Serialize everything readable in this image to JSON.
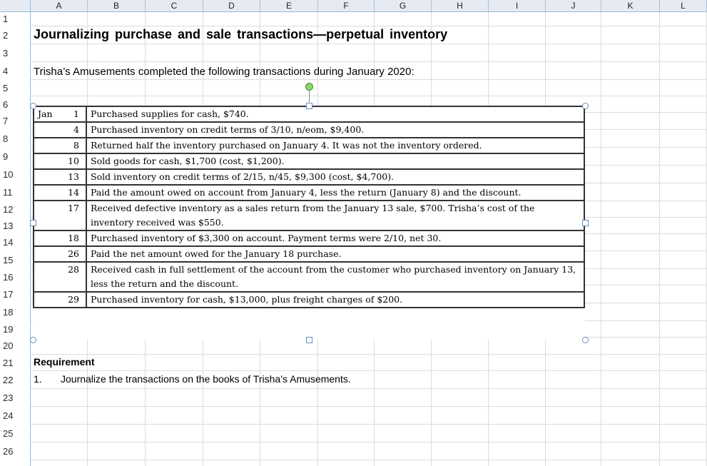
{
  "columns": [
    "A",
    "B",
    "C",
    "D",
    "E",
    "F",
    "G",
    "H",
    "I",
    "J",
    "K",
    "L"
  ],
  "rows": [
    "1",
    "2",
    "3",
    "4",
    "5",
    "6",
    "7",
    "8",
    "9",
    "10",
    "11",
    "12",
    "13",
    "14",
    "15",
    "16",
    "17",
    "18",
    "19",
    "20",
    "21",
    "22",
    "23",
    "24",
    "25",
    "26"
  ],
  "sheet": {
    "title": "Journalizing purchase and sale transactions—perpetual inventory",
    "intro": "Trisha’s Amusements completed the following transactions during January 2020:",
    "requirement_heading": "Requirement",
    "requirement_number": "1.",
    "requirement_text": "Journalize the transactions on the books of Trisha’s Amusements."
  },
  "transactions": [
    {
      "month": "Jan",
      "day": "1",
      "text": "Purchased supplies for cash, $740."
    },
    {
      "month": "",
      "day": "4",
      "text": "Purchased inventory on credit terms of 3/10, n/eom, $9,400."
    },
    {
      "month": "",
      "day": "8",
      "text": "Returned half the inventory purchased on January 4. It was not the inventory ordered."
    },
    {
      "month": "",
      "day": "10",
      "text": "Sold goods for cash, $1,700 (cost, $1,200)."
    },
    {
      "month": "",
      "day": "13",
      "text": "Sold inventory on credit terms of 2/15, n/45, $9,300 (cost, $4,700)."
    },
    {
      "month": "",
      "day": "14",
      "text": "Paid the amount owed on account from January 4, less the return (January 8) and the discount."
    },
    {
      "month": "",
      "day": "17",
      "text": "Received defective inventory as a sales return from the January 13 sale, $700. Trisha’s cost of the inventory received was $550."
    },
    {
      "month": "",
      "day": "18",
      "text": "Purchased inventory of $3,300 on account. Payment terms were 2/10, net 30."
    },
    {
      "month": "",
      "day": "26",
      "text": "Paid the net amount owed for the January 18 purchase."
    },
    {
      "month": "",
      "day": "28",
      "text": "Received cash in full settlement of the account from the customer who purchased inventory on January 13, less the return and the discount."
    },
    {
      "month": "",
      "day": "29",
      "text": "Purchased inventory for cash, $13,000, plus freight charges of $200."
    }
  ]
}
